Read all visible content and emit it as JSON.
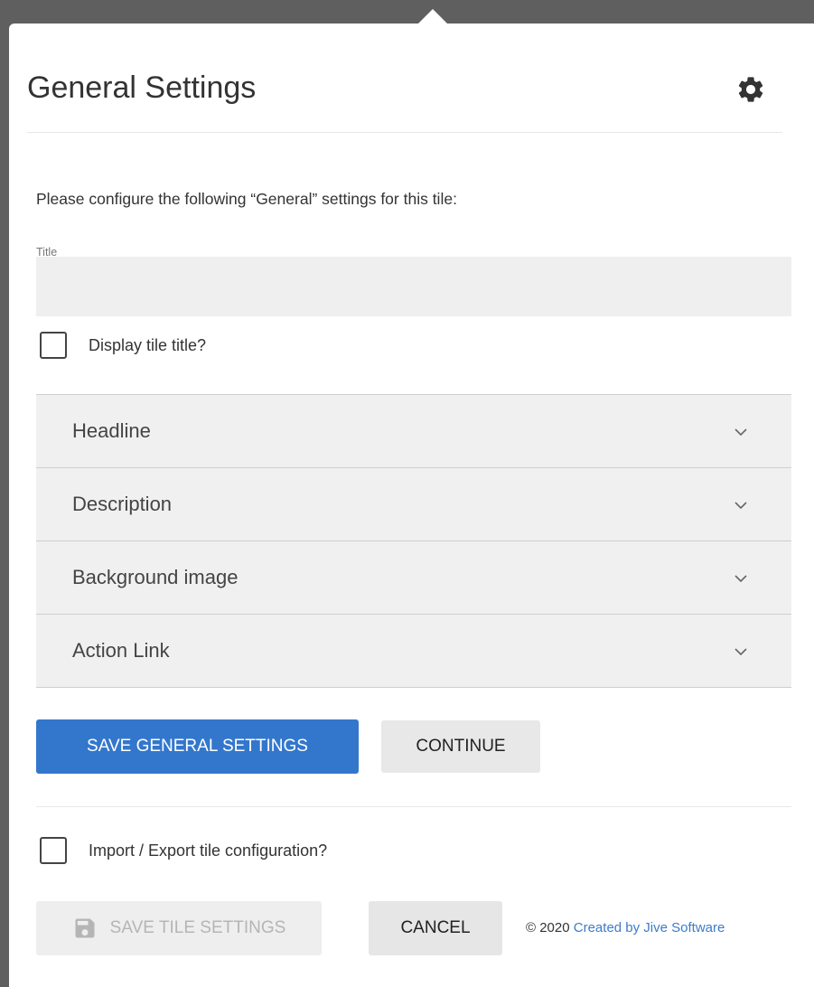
{
  "dialog": {
    "title": "General Settings",
    "intro": "Please configure the following “General” settings for this tile:",
    "title_field": {
      "label": "Title",
      "value": "",
      "placeholder": ""
    },
    "display_title_label": "Display tile title?",
    "display_title_checked": false,
    "accordion": [
      {
        "label": "Headline",
        "icon": "chevron-down-icon"
      },
      {
        "label": "Description",
        "icon": "chevron-down-icon"
      },
      {
        "label": "Background image",
        "icon": "chevron-down-icon"
      },
      {
        "label": "Action Link",
        "icon": "chevron-down-icon"
      }
    ],
    "save_general_label": "SAVE GENERAL SETTINGS",
    "continue_label": "CONTINUE",
    "import_export_label": "Import / Export tile configuration?",
    "import_export_checked": false,
    "save_tile_label": "SAVE TILE SETTINGS",
    "cancel_label": "CANCEL",
    "footer": {
      "copyright": "© 2020",
      "link_text": "Created by Jive Software"
    }
  },
  "colors": {
    "primary": "#3377cc",
    "link": "#3d7cc9",
    "accordion_bg": "#f0f0f0",
    "input_bg": "#efefef"
  }
}
